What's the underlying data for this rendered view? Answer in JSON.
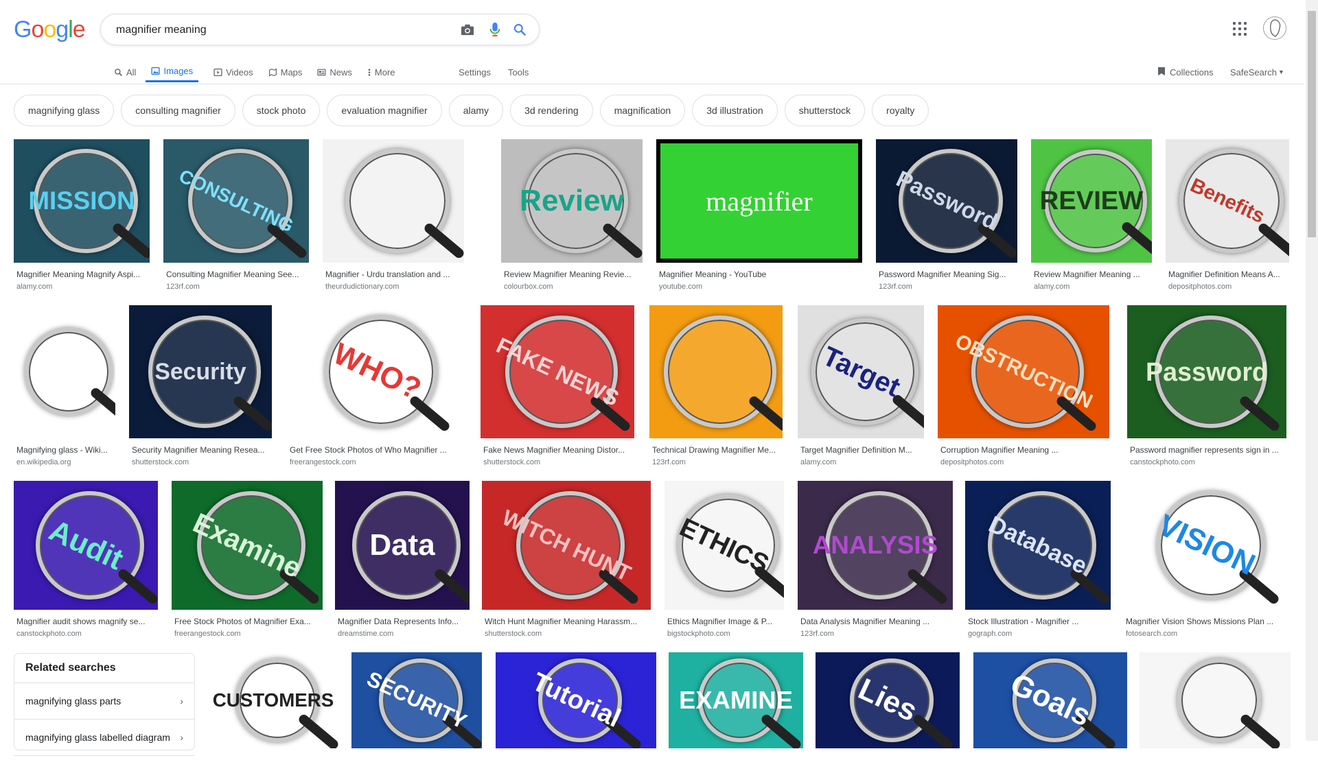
{
  "logo": {
    "letters": [
      "G",
      "o",
      "o",
      "g",
      "l",
      "e"
    ],
    "colors": [
      "#4285f4",
      "#ea4335",
      "#fbbc05",
      "#4285f4",
      "#34a853",
      "#ea4335"
    ]
  },
  "search": {
    "value": "magnifier meaning",
    "placeholder": ""
  },
  "icons": {
    "camera": "camera-icon",
    "mic": "microphone-icon",
    "search": "search-icon",
    "apps": "apps-grid-icon"
  },
  "tabs": [
    {
      "label": "All",
      "icon": "search-icon"
    },
    {
      "label": "Images",
      "icon": "image-icon",
      "active": true
    },
    {
      "label": "Videos",
      "icon": "video-icon"
    },
    {
      "label": "Maps",
      "icon": "map-icon"
    },
    {
      "label": "News",
      "icon": "news-icon"
    },
    {
      "label": "More",
      "icon": "more-vert-icon"
    }
  ],
  "tools": {
    "settings": "Settings",
    "tools": "Tools"
  },
  "right_tools": {
    "collections": "Collections",
    "safesearch": "SafeSearch"
  },
  "chips": [
    "magnifying glass",
    "consulting magnifier",
    "stock photo",
    "evaluation magnifier",
    "alamy",
    "3d rendering",
    "magnification",
    "3d illustration",
    "shutterstock",
    "royalty"
  ],
  "results": [
    {
      "title": "Magnifier Meaning Magnify Aspi...",
      "source": "alamy.com",
      "word": "MISSION",
      "bg": "#1f4e5f",
      "fg": "#5ad0f0"
    },
    {
      "title": "Consulting Magnifier Meaning See...",
      "source": "123rf.com",
      "word": "CONSULTING",
      "bg": "#2a5968",
      "fg": "#7fe0ff"
    },
    {
      "title": "Magnifier - Urdu translation and ...",
      "source": "theurdudictionary.com",
      "word": "",
      "bg": "#f2f2f2",
      "fg": "#333"
    },
    {
      "title": "Review Magnifier Meaning Revie...",
      "source": "colourbox.com",
      "word": "Review",
      "bg": "#bdbdbd",
      "fg": "#17a589"
    },
    {
      "title": "Magnifier Meaning - YouTube",
      "source": "youtube.com",
      "word": "magnifier",
      "bg": "#34d134",
      "fg": "#ffffff"
    },
    {
      "title": "Password Magnifier Meaning Sig...",
      "source": "123rf.com",
      "word": "Password",
      "bg": "#0b1a33",
      "fg": "#cfd8e8"
    },
    {
      "title": "Review Magnifier Meaning ...",
      "source": "alamy.com",
      "word": "REVIEW",
      "bg": "#4fc444",
      "fg": "#1d3d1a"
    },
    {
      "title": "Magnifier Definition Means A...",
      "source": "depositphotos.com",
      "word": "Benefits",
      "bg": "#e8e8e8",
      "fg": "#c0392b"
    },
    {
      "title": "Magnifying glass - Wiki...",
      "source": "en.wikipedia.org",
      "word": "",
      "bg": "#ffffff",
      "fg": "#333"
    },
    {
      "title": "Security Magnifier Meaning Resea...",
      "source": "shutterstock.com",
      "word": "Security",
      "bg": "#0a1c3a",
      "fg": "#d9dde6"
    },
    {
      "title": "Get Free Stock Photos of Who Magnifier ...",
      "source": "freerangestock.com",
      "word": "WHO?",
      "bg": "#ffffff",
      "fg": "#e53935"
    },
    {
      "title": "Fake News Magnifier Meaning Distor...",
      "source": "shutterstock.com",
      "word": "FAKE NEWS",
      "bg": "#d32f2f",
      "fg": "#f5d5d5"
    },
    {
      "title": "Technical Drawing Magnifier Me...",
      "source": "123rf.com",
      "word": "",
      "bg": "#f39c12",
      "fg": "#fff"
    },
    {
      "title": "Target Magnifier Definition M...",
      "source": "alamy.com",
      "word": "Target",
      "bg": "#e0e0e0",
      "fg": "#1a237e"
    },
    {
      "title": "Corruption Magnifier Meaning ...",
      "source": "depositphotos.com",
      "word": "OBSTRUCTION",
      "bg": "#e65100",
      "fg": "#ffe0c0"
    },
    {
      "title": "Password magnifier represents sign in ...",
      "source": "canstockphoto.com",
      "word": "Password",
      "bg": "#1b5e20",
      "fg": "#e0f0d0"
    },
    {
      "title": "Magnifier audit shows magnify se...",
      "source": "canstockphoto.com",
      "word": "Audit",
      "bg": "#3a1ab0",
      "fg": "#6cf0c8"
    },
    {
      "title": "Free Stock Photos of Magnifier Exa...",
      "source": "freerangestock.com",
      "word": "Examine",
      "bg": "#0e6b2a",
      "fg": "#d8f5d8"
    },
    {
      "title": "Magnifier Data Represents Info...",
      "source": "dreamstime.com",
      "word": "Data",
      "bg": "#24124f",
      "fg": "#ffffff"
    },
    {
      "title": "Witch Hunt Magnifier Meaning Harassm...",
      "source": "shutterstock.com",
      "word": "WITCH HUNT",
      "bg": "#c62828",
      "fg": "#f3c0c0"
    },
    {
      "title": "Ethics Magnifier Image & P...",
      "source": "bigstockphoto.com",
      "word": "ETHICS",
      "bg": "#f5f5f5",
      "fg": "#222"
    },
    {
      "title": "Data Analysis Magnifier Meaning ...",
      "source": "123rf.com",
      "word": "ANALYSIS",
      "bg": "#3b2a4a",
      "fg": "#b04ad0"
    },
    {
      "title": "Stock Illustration - Magnifier ...",
      "source": "gograph.com",
      "word": "Database",
      "bg": "#0a1f55",
      "fg": "#dce4f5"
    },
    {
      "title": "Magnifier Vision Shows Missions Plan ...",
      "source": "fotosearch.com",
      "word": "VISION",
      "bg": "#ffffff",
      "fg": "#1e88e5"
    },
    {
      "title": "",
      "source": "",
      "word": "CUSTOMERS",
      "bg": "#ffffff",
      "fg": "#222"
    },
    {
      "title": "",
      "source": "",
      "word": "SECURITY",
      "bg": "#1e4fa0",
      "fg": "#ffffff"
    },
    {
      "title": "",
      "source": "",
      "word": "Tutorial",
      "bg": "#2b23d6",
      "fg": "#ffffff"
    },
    {
      "title": "",
      "source": "",
      "word": "EXAMINE",
      "bg": "#1eb0a0",
      "fg": "#ffffff"
    },
    {
      "title": "",
      "source": "",
      "word": "Lies",
      "bg": "#0c1a5a",
      "fg": "#ffffff"
    },
    {
      "title": "",
      "source": "",
      "word": "Goals",
      "bg": "#1d4fa3",
      "fg": "#ffffff"
    },
    {
      "title": "",
      "source": "",
      "word": "",
      "bg": "#f6f6f6",
      "fg": "#333"
    }
  ],
  "related": {
    "heading": "Related searches",
    "items": [
      "magnifying glass parts",
      "magnifying glass labelled diagram"
    ]
  }
}
